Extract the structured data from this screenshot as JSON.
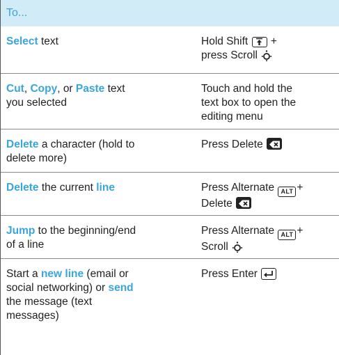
{
  "header": {
    "label": "To..."
  },
  "rows": [
    {
      "left": {
        "kw1": "Select",
        "t1": " text"
      },
      "right": {
        "t1": "Hold Shift ",
        "t2": " +",
        "t3": "press Scroll "
      }
    },
    {
      "left": {
        "kw1": "Cut",
        "t1": ", ",
        "kw2": "Copy",
        "t2": ", or ",
        "kw3": "Paste",
        "t3": " text",
        "t4": "you selected"
      },
      "right": {
        "t1": "Touch and hold the",
        "t2": "text box to open the",
        "t3": "editing menu"
      }
    },
    {
      "left": {
        "kw1": "Delete",
        "t1": " a character (hold to",
        "t2": "delete more)"
      },
      "right": {
        "t1": "Press Delete "
      }
    },
    {
      "left": {
        "kw1": "Delete",
        "t1": " the current ",
        "kw2": "line"
      },
      "right": {
        "t1": "Press Alternate ",
        "t2": "+",
        "t3": "Delete "
      }
    },
    {
      "left": {
        "kw1": "Jump",
        "t1": " to the beginning/end",
        "t2": "of a line"
      },
      "right": {
        "t1": "Press Alternate ",
        "t2": "+",
        "t3": "Scroll "
      }
    },
    {
      "left": {
        "t1": "Start a ",
        "kw1": "new line",
        "t2": " (email or",
        "t3": "social networking) or ",
        "kw2": "send",
        "t4": "the message (text",
        "t5": "messages)"
      },
      "right": {
        "t1": "Press Enter "
      }
    }
  ],
  "keys": {
    "alt": "ALT"
  },
  "colors": {
    "accent": "#3aa5dc",
    "header_bg": "#d1ecf7",
    "rule": "#8a8a8a"
  },
  "icons": {
    "shift": "shift-key-icon",
    "scroll": "scroll-navigation-icon",
    "delete": "delete-key-icon",
    "alt": "alt-key-icon",
    "enter": "enter-key-icon"
  }
}
